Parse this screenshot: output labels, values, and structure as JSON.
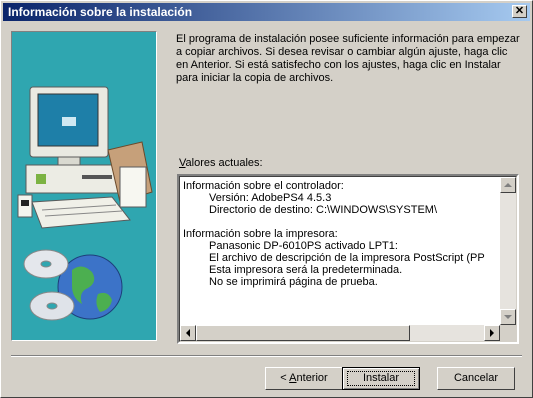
{
  "window": {
    "title": "Información sobre la instalación",
    "close_glyph": "✕"
  },
  "intro_text": "El programa de instalación posee suficiente información para empezar a copiar archivos. Si desea revisar o cambiar algún ajuste, haga clic en Anterior. Si está satisfecho con los ajustes, haga clic en Instalar para iniciar la copia de archivos.",
  "current_values": {
    "label_accel": "V",
    "label_rest": "alores actuales:"
  },
  "details": {
    "driver_header": "Información sobre el controlador:",
    "driver_version": "Versión: AdobePS4 4.5.3",
    "driver_dest": "Directorio de destino: C:\\WINDOWS\\SYSTEM\\",
    "printer_header": "Información sobre la impresora:",
    "printer_model": "Panasonic DP-6010PS activado LPT1:",
    "printer_ppd": "El archivo de descripción de la impresora PostScript (PP",
    "printer_default": "Esta impresora será la predeterminada.",
    "printer_test": "No se imprimirá página de prueba."
  },
  "buttons": {
    "back_prefix": "< ",
    "back_accel": "A",
    "back_rest": "nterior",
    "install": "Instalar",
    "cancel": "Cancelar"
  },
  "icons": [
    "computer-illustration",
    "globe-icon",
    "cd-icon",
    "scroll-up-icon",
    "scroll-down-icon",
    "scroll-left-icon",
    "scroll-right-icon"
  ],
  "colors": {
    "title_start": "#0a246a",
    "title_end": "#a6caf0",
    "banner": "#2fa6b0",
    "face": "#d4d0c8"
  }
}
